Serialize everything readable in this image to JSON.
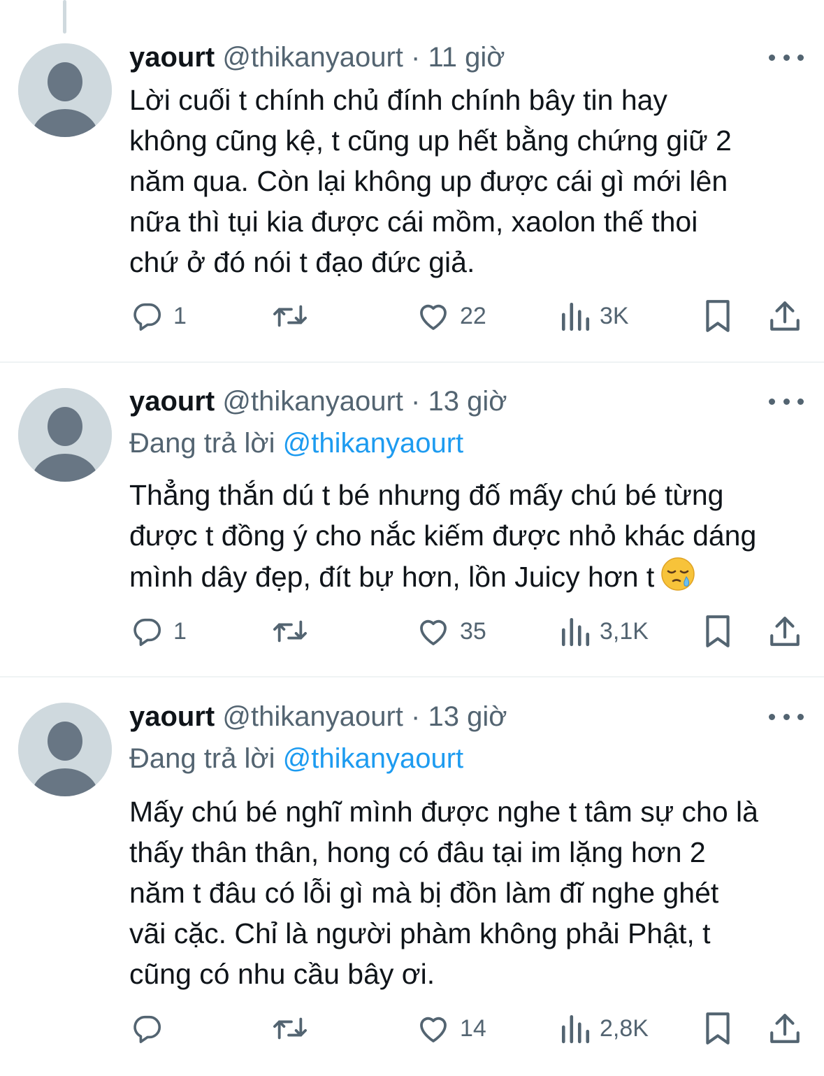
{
  "tweets": [
    {
      "name": "yaourt",
      "handle": "@thikanyaourt",
      "dot": "·",
      "time": "11 giờ",
      "reply_prefix": "",
      "reply_mention": "",
      "lines": [
        "Lời cuối t chính chủ đính chính bây tin hay",
        "không cũng kệ, t cũng up hết bằng chứng giữ 2",
        "năm qua. Còn lại không up được cái gì mới lên",
        "nữa thì tụi kia được cái mồm, xaolon thế thoi",
        "chứ ở đó nói t đạo đức giả."
      ],
      "replies": "1",
      "reposts": "",
      "likes": "22",
      "views": "3K"
    },
    {
      "name": "yaourt",
      "handle": "@thikanyaourt",
      "dot": "·",
      "time": "13 giờ",
      "reply_prefix": "Đang trả lời ",
      "reply_mention": "@thikanyaourt",
      "lines": [
        "Thẳng thắn dú t bé nhưng đố mấy chú bé từng",
        "được t đồng ý cho nắc kiếm được nhỏ khác dáng",
        "mình dây đẹp, đít bự hơn, lồn Juicy hơn t"
      ],
      "emoji": "sleepy-face-emoji",
      "replies": "1",
      "reposts": "",
      "likes": "35",
      "views": "3,1K"
    },
    {
      "name": "yaourt",
      "handle": "@thikanyaourt",
      "dot": "·",
      "time": "13 giờ",
      "reply_prefix": "Đang trả lời ",
      "reply_mention": "@thikanyaourt",
      "lines": [
        "Mấy chú bé nghĩ mình được nghe t tâm sự cho là",
        "thấy thân thân, hong có đâu tại im lặng hơn 2",
        "năm t đâu có lỗi gì mà bị đồn làm đĩ nghe ghét",
        "vãi cặc. Chỉ là người phàm không phải Phật, t",
        "cũng có nhu cầu bây ơi."
      ],
      "replies": "",
      "reposts": "",
      "likes": "14",
      "views": "2,8K"
    }
  ],
  "icons": {
    "reply": "speech-bubble-icon",
    "repost": "repost-arrows-icon",
    "like": "heart-icon",
    "views": "bar-chart-icon",
    "bookmark": "bookmark-icon",
    "share": "share-upload-icon",
    "more": "more-dots-icon"
  },
  "colors": {
    "text": "#0f1419",
    "secondary": "#536471",
    "link": "#1d9bf0",
    "divider": "#eff3f4",
    "avatar_bg": "#cfd9de",
    "avatar_fg": "#687684"
  }
}
